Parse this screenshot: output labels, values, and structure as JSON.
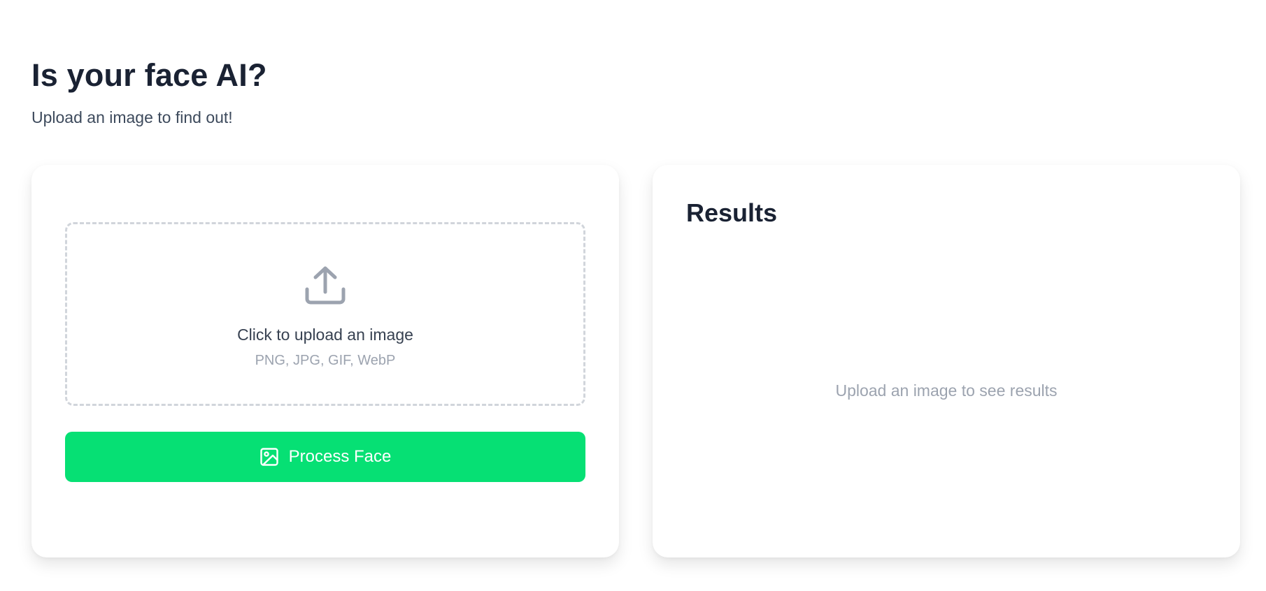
{
  "header": {
    "title": "Is your face AI?",
    "subtitle": "Upload an image to find out!"
  },
  "upload": {
    "label": "Click to upload an image",
    "formats": "PNG, JPG, GIF, WebP",
    "icon": "upload-icon"
  },
  "actions": {
    "process_label": "Process Face",
    "process_icon": "image-icon",
    "accent_color": "#06e074"
  },
  "results": {
    "title": "Results",
    "empty_message": "Upload an image to see results"
  },
  "colors": {
    "heading": "#1a2233",
    "muted": "#9ca3af",
    "border_dashed": "#d1d5db"
  }
}
